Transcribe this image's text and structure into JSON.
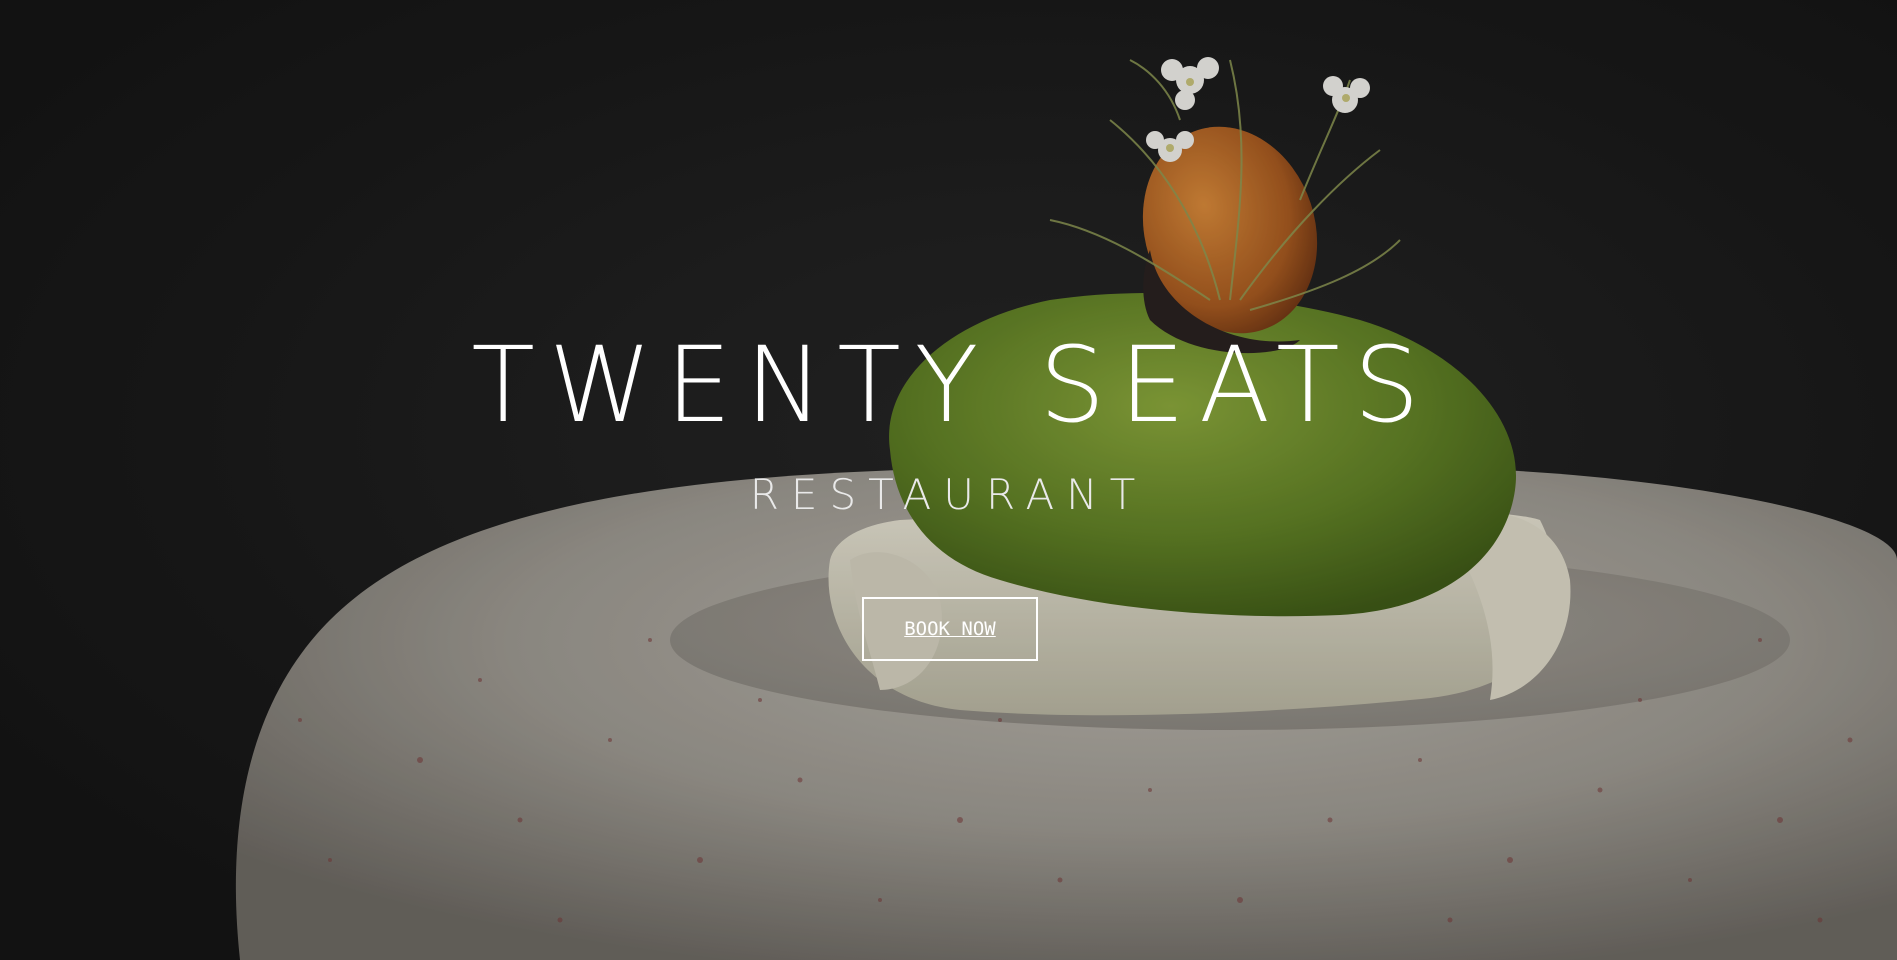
{
  "hero": {
    "title": "TWENTY SEATS",
    "subtitle": "RESTAURANT",
    "cta_label": "BOOK NOW"
  },
  "colors": {
    "background": "#1b1b1b",
    "text": "#ffffff",
    "button_border": "#ffffff"
  }
}
